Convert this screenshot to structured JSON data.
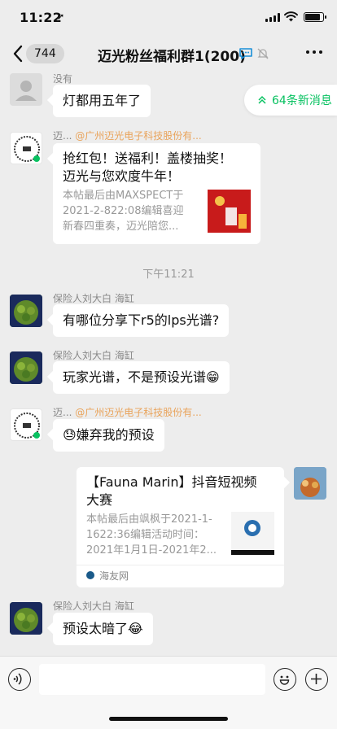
{
  "status_bar": {
    "time": "11:22",
    "location_glyph": "➚"
  },
  "nav": {
    "back_count": "744",
    "title": "迈光粉丝福利群1(200)",
    "icons": [
      "back-chevron-icon",
      "group-chat-icon",
      "mute-bell-icon",
      "more-dots-icon"
    ]
  },
  "new_messages": {
    "label": "64条新消息",
    "icon": "double-chevron-up-icon"
  },
  "messages": [
    {
      "sender": "没有",
      "text": "灯都用五年了"
    },
    {
      "sender": "迈...",
      "sender_org": "@广州迈光电子科技股份有...",
      "card_title_1": "抢红包！送福利！盖楼抽奖！",
      "card_title_2": "迈光与您欢度牛年！",
      "card_desc_1": "本帖最后由MAXSPECT于",
      "card_desc_2": "2021-2-822:08编辑喜迎",
      "card_desc_3": "新春四重奏，迈光陪您..."
    },
    {
      "timestamp": "下午11:21"
    },
    {
      "sender": "保险人刘大白 海缸",
      "text": "有哪位分享下r5的lps光谱?"
    },
    {
      "sender": "保险人刘大白 海缸",
      "text": "玩家光谱，不是预设光谱😁"
    },
    {
      "sender": "迈...",
      "sender_org": "@广州迈光电子科技股份有...",
      "text": "😓嫌弃我的预设"
    },
    {
      "self": true,
      "card_title_1": "【Fauna Marin】抖音短视频",
      "card_title_2": "大赛",
      "card_desc_1": "本帖最后由飒枫于2021-1-",
      "card_desc_2": "1622:36编辑活动时间：",
      "card_desc_3": "2021年1月1日-2021年2...",
      "source": "海友网"
    },
    {
      "sender": "保险人刘大白 海缸",
      "text": "预设太暗了😂"
    }
  ],
  "colors": {
    "accent": "#07c160",
    "org": "#e9a35a",
    "background": "#ededed"
  }
}
